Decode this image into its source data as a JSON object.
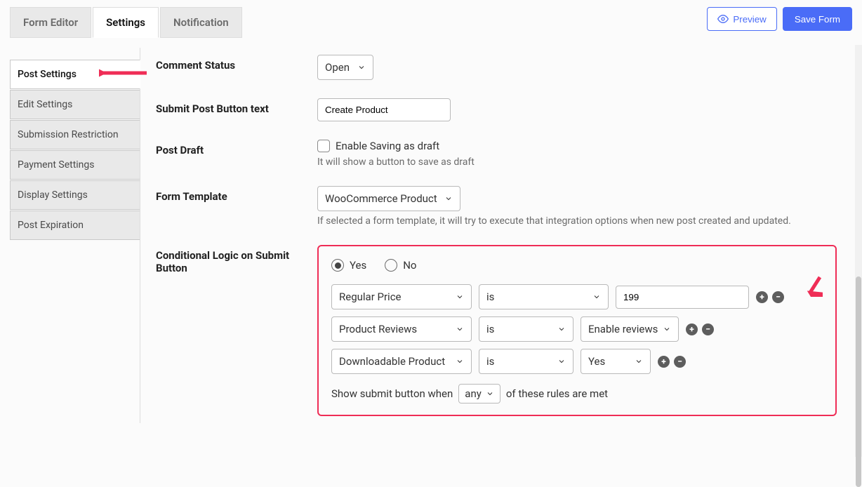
{
  "tabs": {
    "form_editor": "Form Editor",
    "settings": "Settings",
    "notification": "Notification"
  },
  "actions": {
    "preview": "Preview",
    "save": "Save Form"
  },
  "sidebar": {
    "items": [
      "Post Settings",
      "Edit Settings",
      "Submission Restriction",
      "Payment Settings",
      "Display Settings",
      "Post Expiration"
    ]
  },
  "fields": {
    "comment_status": {
      "label": "Comment Status",
      "value": "Open"
    },
    "submit_button": {
      "label": "Submit Post Button text",
      "value": "Create Product"
    },
    "post_draft": {
      "label": "Post Draft",
      "checkbox_label": "Enable Saving as draft",
      "help": "It will show a button to save as draft"
    },
    "form_template": {
      "label": "Form Template",
      "value": "WooCommerce Product",
      "help": "If selected a form template, it will try to execute that integration options when new post created and updated."
    },
    "conditional": {
      "label": "Conditional Logic on Submit Button",
      "yes": "Yes",
      "no": "No",
      "rules": [
        {
          "field": "Regular Price",
          "operator": "is",
          "value": "199",
          "value_type": "text"
        },
        {
          "field": "Product Reviews",
          "operator": "is",
          "value": "Enable reviews",
          "value_type": "select"
        },
        {
          "field": "Downloadable Product",
          "operator": "is",
          "value": "Yes",
          "value_type": "select"
        }
      ],
      "summary_pre": "Show submit button when",
      "summary_match": "any",
      "summary_post": "of these rules are met"
    }
  }
}
